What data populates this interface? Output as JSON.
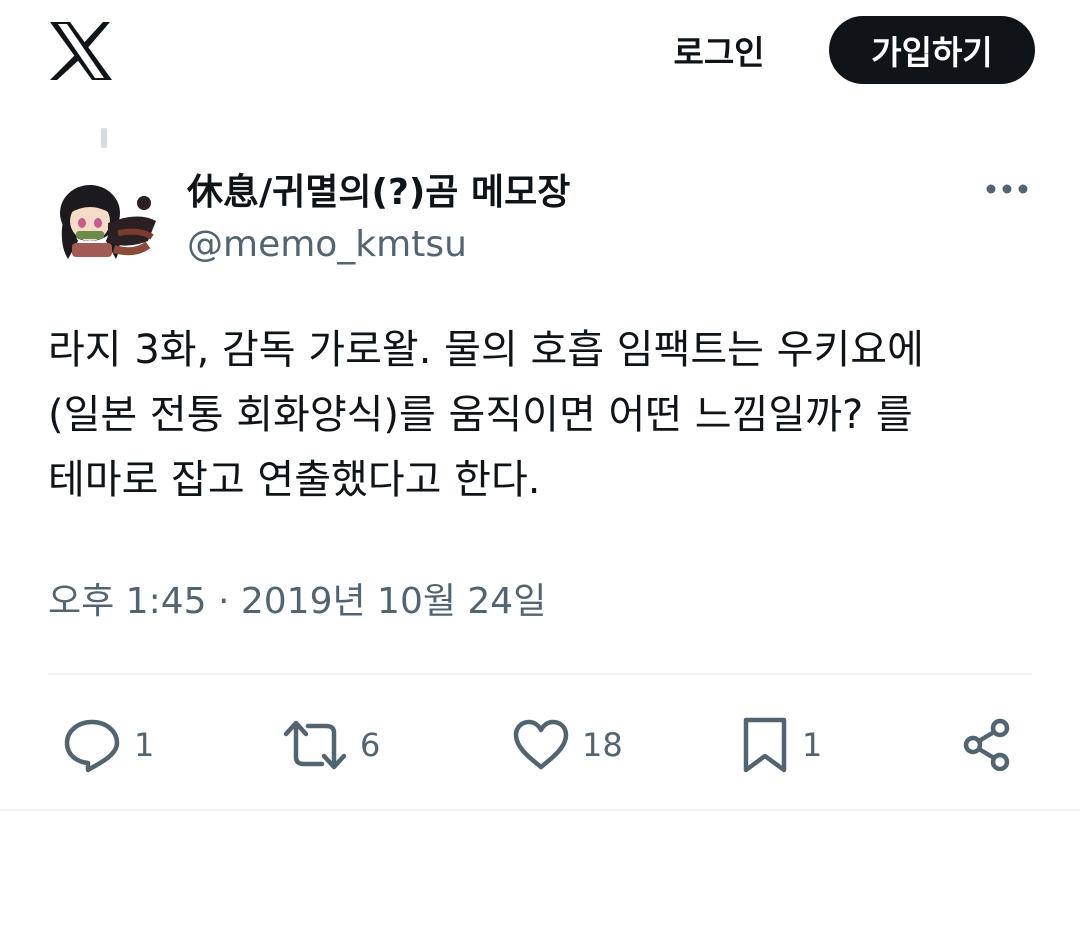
{
  "header": {
    "logo_icon": "x-logo-icon",
    "login_label": "로그인",
    "signup_label": "가입하기"
  },
  "tweet": {
    "author": {
      "display_name": "休息/귀멸의(?)곰 메모장",
      "handle": "@memo_kmtsu",
      "avatar_icon": "avatar-illustration"
    },
    "more_icon": "more-dots-icon",
    "text": "라지 3화, 감독 가로왈. 물의 호흡 임팩트는 우키요에\n(일본 전통 회화양식)를 움직이면 어떤 느낌일까? 를\n테마로 잡고 연출했다고 한다.",
    "timestamp": "오후 1:45 · 2019년 10월 24일",
    "actions": {
      "reply": {
        "icon": "reply-icon",
        "count": "1"
      },
      "retweet": {
        "icon": "retweet-icon",
        "count": "6"
      },
      "like": {
        "icon": "heart-icon",
        "count": "18"
      },
      "bookmark": {
        "icon": "bookmark-icon",
        "count": "1"
      },
      "share": {
        "icon": "share-icon"
      }
    }
  },
  "colors": {
    "text_primary": "#0f1419",
    "text_secondary": "#536471",
    "button_dark": "#0f1419",
    "divider": "#eff3f4"
  }
}
